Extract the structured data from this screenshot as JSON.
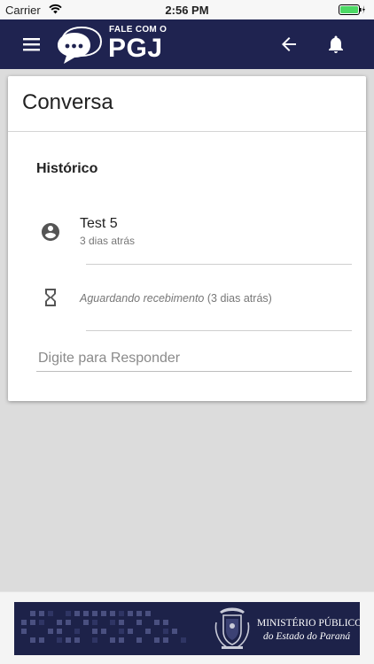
{
  "status_bar": {
    "carrier": "Carrier",
    "time": "2:56 PM",
    "wifi_icon": "wifi-icon",
    "battery_icon": "battery-charging-icon"
  },
  "header": {
    "logo_top": "FALE COM O",
    "logo_main": "PGJ",
    "menu_icon": "hamburger-menu-icon",
    "back_icon": "arrow-back-icon",
    "notification_icon": "bell-icon",
    "background_color": "#1f2350"
  },
  "card": {
    "title": "Conversa",
    "section_label": "Histórico",
    "messages": [
      {
        "icon": "account-circle-icon",
        "title": "Test 5",
        "subtitle": "3 dias atrás"
      }
    ],
    "pending": {
      "icon": "hourglass-icon",
      "status": "Aguardando recebimento",
      "time": "(3 dias atrás)"
    },
    "reply": {
      "value": "",
      "placeholder": "Digite para Responder"
    }
  },
  "footer": {
    "org_line1": "MINISTÉRIO PÚBLICO",
    "org_line2": "do Estado do Paraná",
    "crest_icon": "coat-of-arms-icon",
    "banner_color": "#1d2249"
  }
}
